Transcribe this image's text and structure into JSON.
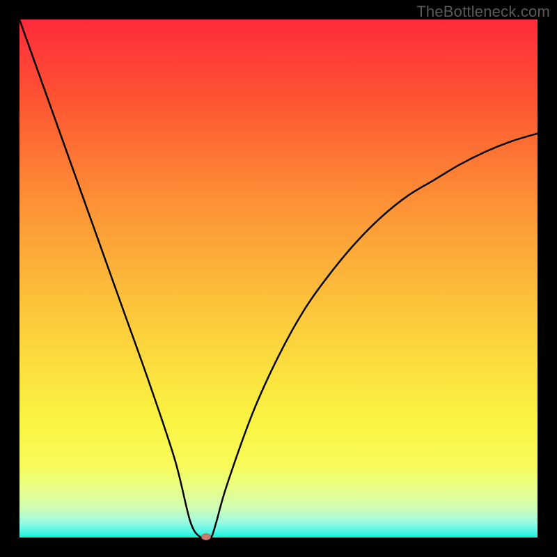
{
  "watermark": "TheBottleneck.com",
  "colors": {
    "frame": "#000000",
    "curve_stroke": "#000000",
    "marker_fill": "#c97b6f",
    "gradient_top": "#fe2b39",
    "gradient_bottom": "#0df4d0"
  },
  "chart_data": {
    "type": "line",
    "title": "",
    "xlabel": "",
    "ylabel": "",
    "xlim": [
      0,
      100
    ],
    "ylim": [
      0,
      100
    ],
    "series": [
      {
        "name": "bottleneck-curve",
        "x": [
          0,
          5,
          10,
          15,
          20,
          25,
          30,
          33,
          35,
          36,
          37,
          38,
          40,
          45,
          50,
          55,
          60,
          65,
          70,
          75,
          80,
          85,
          90,
          95,
          100
        ],
        "values": [
          100,
          86,
          72,
          58,
          44,
          30,
          15,
          3,
          0,
          0,
          0,
          3,
          10,
          24,
          35,
          44,
          51,
          57,
          62,
          66,
          69,
          72,
          74.5,
          76.5,
          78
        ]
      }
    ],
    "marker": {
      "x": 36,
      "y": 0
    },
    "annotations": []
  }
}
